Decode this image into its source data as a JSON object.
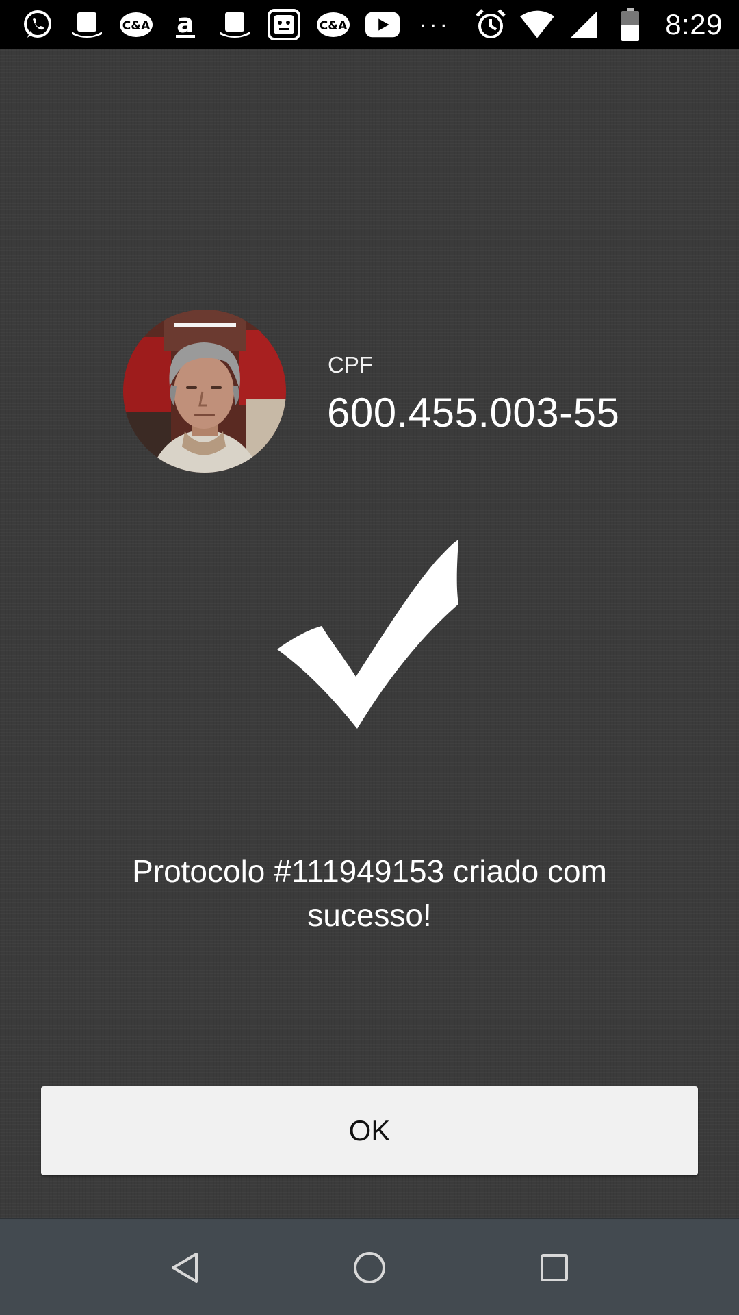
{
  "status_bar": {
    "time": "8:29",
    "left_icons": [
      "whatsapp-icon",
      "hat-icon",
      "ca-icon",
      "amazon-icon",
      "hat-icon",
      "robot-icon",
      "ca-icon",
      "youtube-icon"
    ],
    "overflow": "···",
    "right_icons": [
      "alarm-icon",
      "wifi-icon",
      "signal-icon",
      "battery-icon"
    ]
  },
  "profile": {
    "cpf_label": "CPF",
    "cpf_value": "600.455.003-55"
  },
  "message": "Protocolo #111949153 criado com sucesso!",
  "ok_button": {
    "label": "OK"
  },
  "colors": {
    "background": "#3b3b3b",
    "button_bg": "#f1f1f1",
    "nav_bar": "#434a50",
    "status_bar": "#000000"
  },
  "nav": {
    "icons": [
      "back-icon",
      "home-icon",
      "recents-icon"
    ]
  }
}
